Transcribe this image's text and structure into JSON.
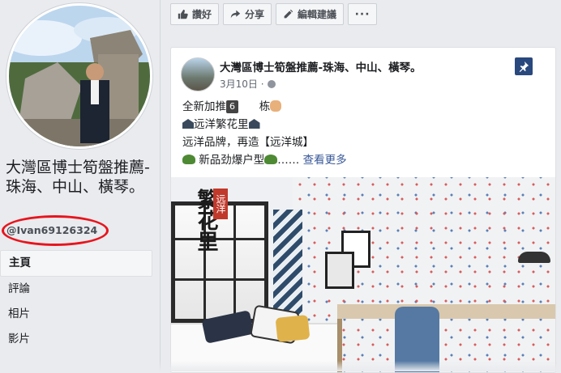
{
  "sidebar": {
    "page_name": "大灣區博士筍盤推薦-珠海、中山、橫琴。",
    "username": "@Ivan69126324",
    "nav": [
      "主頁",
      "評論",
      "相片",
      "影片"
    ]
  },
  "actionbar": {
    "like": "讚好",
    "share": "分享",
    "suggest_edit": "編輯建議",
    "more": "···"
  },
  "post": {
    "title": "大灣區博士筍盤推薦-珠海、中山、橫琴。",
    "date": "3月10日 · ",
    "line1_prefix": "全新加推",
    "line1_num": "6",
    "line1_suffix": "栋",
    "line2": "远洋繁花里",
    "line3": "远洋品牌，再造【远洋城】",
    "line4": "新品劲爆户型",
    "line4_ellipsis": "…… ",
    "see_more": "查看更多"
  },
  "photo": {
    "brand_text": "繁花里",
    "brand_tag": "远洋"
  },
  "colors": {
    "pin": "#29487d",
    "link": "#385898",
    "highlight_oval": "#e8141d"
  }
}
